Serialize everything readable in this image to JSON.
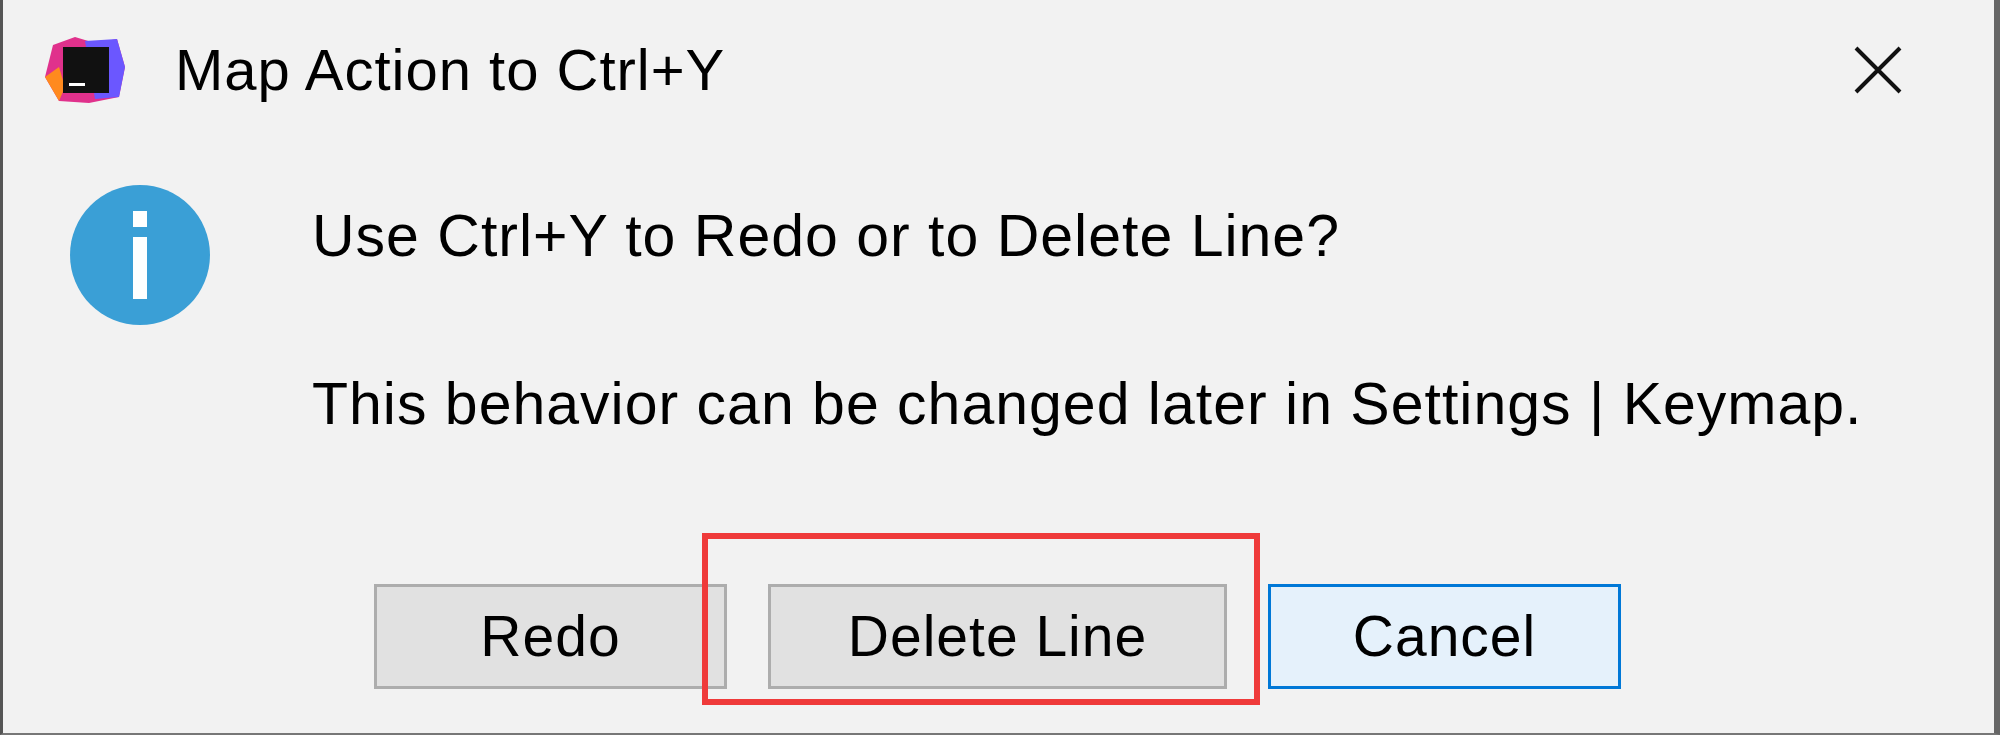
{
  "window": {
    "title": "Map Action to Ctrl+Y"
  },
  "message": {
    "lines": [
      "Use Ctrl+Y to Redo or to Delete Line?",
      "This behavior can be changed later in Settings | Keymap."
    ]
  },
  "buttons": [
    {
      "label": "Redo",
      "default": false,
      "highlighted": false
    },
    {
      "label": "Delete Line",
      "default": false,
      "highlighted": true
    },
    {
      "label": "Cancel",
      "default": true,
      "highlighted": false
    }
  ]
}
